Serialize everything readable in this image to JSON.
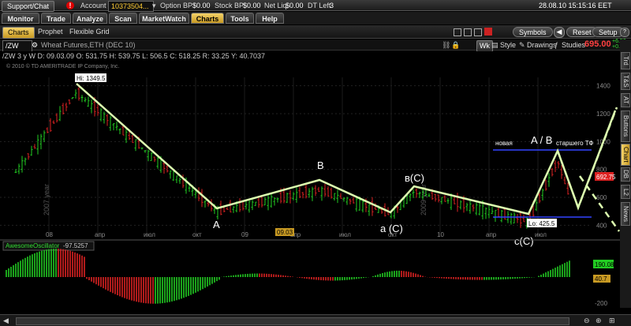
{
  "topbar": {
    "support_label": "Support/Chat",
    "alert_glyph": "!",
    "account_label": "Account",
    "account_value": "10373504...",
    "option_bp_label": "Option BP",
    "option_bp_value": "$0.00",
    "stock_bp_label": "Stock BP",
    "stock_bp_value": "$0.00",
    "net_liq_label": "Net Liq",
    "net_liq_value": "$0.00",
    "dt_left_label": "DT Left",
    "dt_left_value": "3",
    "datetime": "28.08.10 15:15:16 EET"
  },
  "menu": {
    "tabs": [
      {
        "label": "Monitor"
      },
      {
        "label": "Trade"
      },
      {
        "label": "Analyze"
      },
      {
        "label": "Scan"
      },
      {
        "label": "MarketWatch"
      },
      {
        "label": "Charts"
      },
      {
        "label": "Tools"
      },
      {
        "label": "Help"
      }
    ],
    "active": "Charts"
  },
  "subtabs": {
    "items": [
      {
        "label": "Charts"
      },
      {
        "label": "Prophet"
      },
      {
        "label": "Flexible Grid"
      }
    ],
    "symbols_label": "Symbols",
    "reset_label": "Reset",
    "setup_label": "Setup"
  },
  "toolbar": {
    "symbol": "/ZW",
    "description": "Wheat Futures,ETH (DEC 10)",
    "wk_label": "Wk",
    "style_label": "Style",
    "drawings_label": "Drawings",
    "studies_label": "Studies",
    "price": "695.00",
    "change_pts": "+6.50",
    "change_pct": "+0.94%"
  },
  "infobar": {
    "ohlc": "/ZW 3 y W  D: 09.03.09  O: 531.75  H: 539.75  L: 506.5  C: 518.25  R: 33.25  Y: 40.7037",
    "copyright": "© 2010 © TD AMERITRADE IP Company, Inc."
  },
  "sidebar": {
    "tabs": [
      {
        "label": "Trd"
      },
      {
        "label": "T&S"
      },
      {
        "label": "AT"
      },
      {
        "label": "Buttons"
      },
      {
        "label": "Chart"
      },
      {
        "label": "DB"
      },
      {
        "label": "L2"
      },
      {
        "label": "News"
      }
    ],
    "active": "Chart"
  },
  "annotations": {
    "hi_label": "Hi: 1349.5",
    "lo_label": "Lo: 425.5",
    "wave_a": "A",
    "wave_b": "B",
    "wave_a_c": "a (C)",
    "wave_b_c": "в(C)",
    "wave_c_c": "c(C)",
    "wave_ab_big": "A / B",
    "new_label": "новая",
    "senior_label": "старшего ТФ",
    "year_watermark_1": "2007 year",
    "year_watermark_2": "2009 year",
    "current_price_tag": "692.75",
    "cursor_date": "09.03"
  },
  "price_chart": {
    "y_ticks": [
      "1400",
      "1200",
      "1000",
      "800",
      "600",
      "400"
    ],
    "x_ticks": [
      "08",
      "апр",
      "июл",
      "окт",
      "09",
      "апр",
      "июл",
      "окт",
      "10",
      "апр",
      "июл"
    ]
  },
  "oscillator": {
    "name": "AwesomeOscillator",
    "value": "-97.5257",
    "y_ticks": [
      "0",
      "-200"
    ],
    "tag_high": "190.08",
    "tag_mid": "40.7"
  },
  "chart_data": {
    "type": "line",
    "title": "Wheat Futures,ETH (DEC 10)",
    "xlabel": "",
    "ylabel": "",
    "ylim": [
      340,
      1460
    ],
    "x": [
      "2007-10",
      "2008-03",
      "2008-10",
      "2009-02",
      "2009-06",
      "2009-11",
      "2010-01",
      "2010-06",
      "2010-08",
      "2010-09",
      "2010-10",
      "2010-11"
    ],
    "series": [
      {
        "values": [
          780,
          1349.5,
          640,
          500,
          640,
          480,
          700,
          460,
          426,
          860,
          600,
          880
        ]
      }
    ],
    "elliott_wave": {
      "labels": [
        "A",
        "B",
        "a (C)",
        "в(C)",
        "c(C)",
        "A / B"
      ],
      "pivots": [
        {
          "x": "2008-02",
          "y": 1349.5
        },
        {
          "x": "2008-12",
          "y": 490
        },
        {
          "x": "2009-06",
          "y": 650
        },
        {
          "x": "2009-11",
          "y": 500
        },
        {
          "x": "2010-01",
          "y": 640
        },
        {
          "x": "2010-07",
          "y": 426
        },
        {
          "x": "2010-09",
          "y": 880
        },
        {
          "x": "2010-10",
          "y": 570
        },
        {
          "x": "2010-11",
          "y": 1020
        }
      ]
    },
    "horizontal_lines": [
      {
        "y": 860,
        "color": "#3344ff"
      },
      {
        "y": 415,
        "color": "#3344ff"
      }
    ],
    "colors": {
      "up_bar": "#22cc22",
      "down_bar": "#dd2222",
      "wave_line": "#ddffb0"
    }
  }
}
